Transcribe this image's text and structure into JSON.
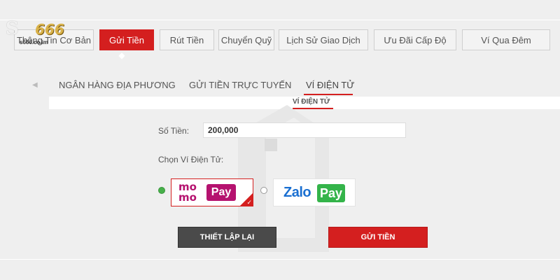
{
  "logo": {
    "text": "S666",
    "number": "666",
    "domain": "s666.co.im"
  },
  "tabs": [
    {
      "label": "Thông Tin Cơ Bản",
      "active": false
    },
    {
      "label": "Gửi Tiền",
      "active": true
    },
    {
      "label": "Rút Tiền",
      "active": false
    },
    {
      "label": "Chuyển Quỹ",
      "active": false
    },
    {
      "label": "Lịch Sử Giao Dịch",
      "active": false
    },
    {
      "label": "Ưu Đãi Cấp Độ",
      "active": false
    },
    {
      "label": "Ví Qua Đêm",
      "active": false
    }
  ],
  "subtabs": [
    {
      "label": "NGÂN HÀNG ĐỊA PHƯƠNG",
      "active": false
    },
    {
      "label": "GỬI TIỀN TRỰC TUYẾN",
      "active": false
    },
    {
      "label": "VÍ ĐIỆN TỬ",
      "active": true
    }
  ],
  "panel": {
    "sub_label": "VÍ ĐIỆN TỬ"
  },
  "form": {
    "amount_label": "Số Tiền:",
    "amount_value": "200,000",
    "wallet_label": "Chọn Ví Điện Tử:",
    "wallets": [
      {
        "name": "MoMo",
        "logo_top": "mo",
        "logo_bottom": "mo",
        "logo_pay": "Pay",
        "selected": true
      },
      {
        "name": "ZaloPay",
        "logo_text": "Zalo",
        "logo_pay": "Pay",
        "selected": false
      }
    ]
  },
  "buttons": {
    "reset_label": "THIẾT LẬP LẠI",
    "submit_label": "GỬI TIỀN"
  },
  "colors": {
    "accent": "#d41f1f",
    "momo": "#b5126f",
    "zalo_blue": "#1a6fd1",
    "zalo_green": "#34b44a",
    "radio_selected": "#46b04a"
  }
}
